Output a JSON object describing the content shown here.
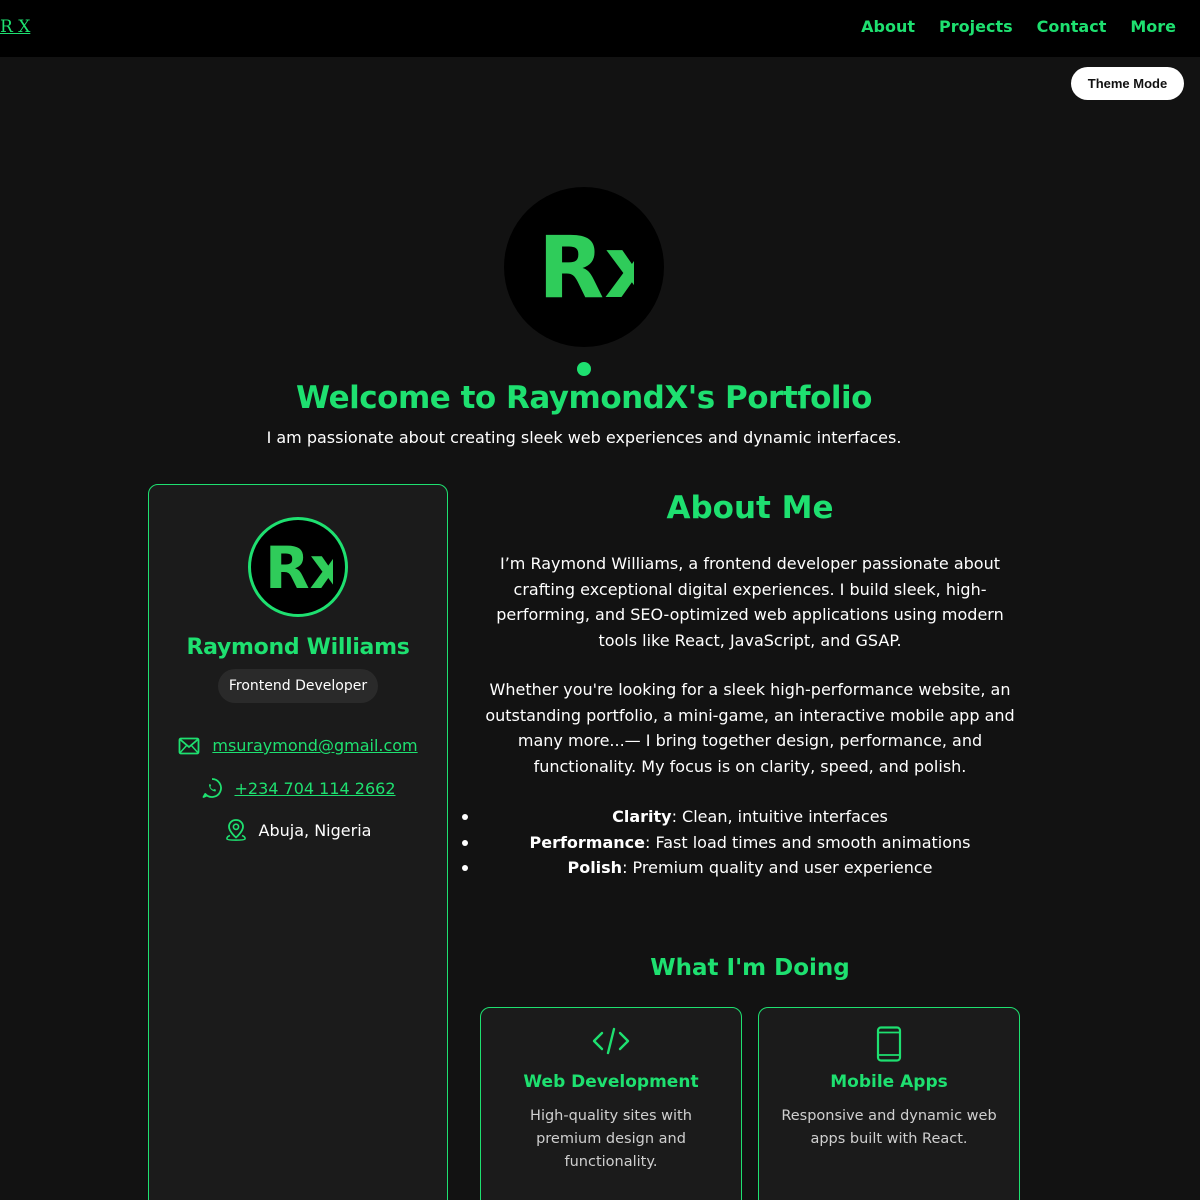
{
  "brand": "R X",
  "nav": {
    "items": [
      "About",
      "Projects",
      "Contact",
      "More"
    ]
  },
  "theme_button": "Theme Mode",
  "hero": {
    "logo_text": "Rx",
    "title": "Welcome to RaymondX's Portfolio",
    "subtitle": "I am passionate about creating sleek web experiences and dynamic interfaces."
  },
  "profile": {
    "avatar_text": "Rx",
    "name": "Raymond Williams",
    "role": "Frontend Developer",
    "email": "msuraymond@gmail.com",
    "phone": "+234 704 114 2662",
    "location": "Abuja, Nigeria"
  },
  "about": {
    "title": "About Me",
    "paragraphs": [
      "I’m Raymond Williams, a frontend developer passionate about crafting exceptional digital experiences. I build sleek, high-performing, and SEO-optimized web applications using modern tools like React, JavaScript, and GSAP.",
      "Whether you're looking for a sleek high-performance website, an outstanding portfolio, a mini-game, an interactive mobile app and many more...— I bring together design, performance, and functionality. My focus is on clarity, speed, and polish."
    ],
    "bullets": [
      {
        "term": "Clarity",
        "text": ": Clean, intuitive interfaces"
      },
      {
        "term": "Performance",
        "text": ": Fast load times and smooth animations"
      },
      {
        "term": "Polish",
        "text": ": Premium quality and user experience"
      }
    ]
  },
  "doing": {
    "title": "What I'm Doing",
    "services": [
      {
        "icon": "code-icon",
        "title": "Web Development",
        "description": "High-quality sites with premium design and functionality."
      },
      {
        "icon": "mobile-icon",
        "title": "Mobile Apps",
        "description": "Responsive and dynamic web apps built with React."
      }
    ]
  },
  "colors": {
    "accent": "#1ee070",
    "background": "#121212",
    "card": "#1b1b1b",
    "topbar": "#000000"
  }
}
